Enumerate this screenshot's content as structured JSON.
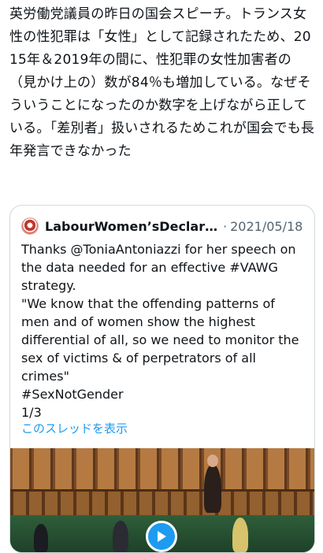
{
  "tweet": {
    "text": "英労働党議員の昨日の国会スピーチ。トランス女性の性犯罪は「女性」として記録されたため、2015年＆2019年の間に、性犯罪の女性加害者の（見かけ上の）数が84％も増加している。なぜそういうことになったのか数字を上げながら正している。「差別者」扱いされるためこれが国会でも長年発言できなかった"
  },
  "quote": {
    "author": "LabourWomen’sDeclarati…",
    "separator": "·",
    "date": "2021/05/18",
    "text": "Thanks @ToniaAntoniazzi for her speech on the data needed for an effective #VAWG strategy.\n \"We know that the offending patterns of men and of women show the highest differential of all, so we need to monitor the sex of victims & of perpetrators of all crimes\"\n#SexNotGender\n1/3",
    "thread_link": "このスレッドを表示",
    "avatar_icon": "campaign-logo-icon",
    "media_icon": "play-icon"
  },
  "colors": {
    "link": "#1d9bf0",
    "secondary": "#536471",
    "border": "#cfd9de"
  }
}
